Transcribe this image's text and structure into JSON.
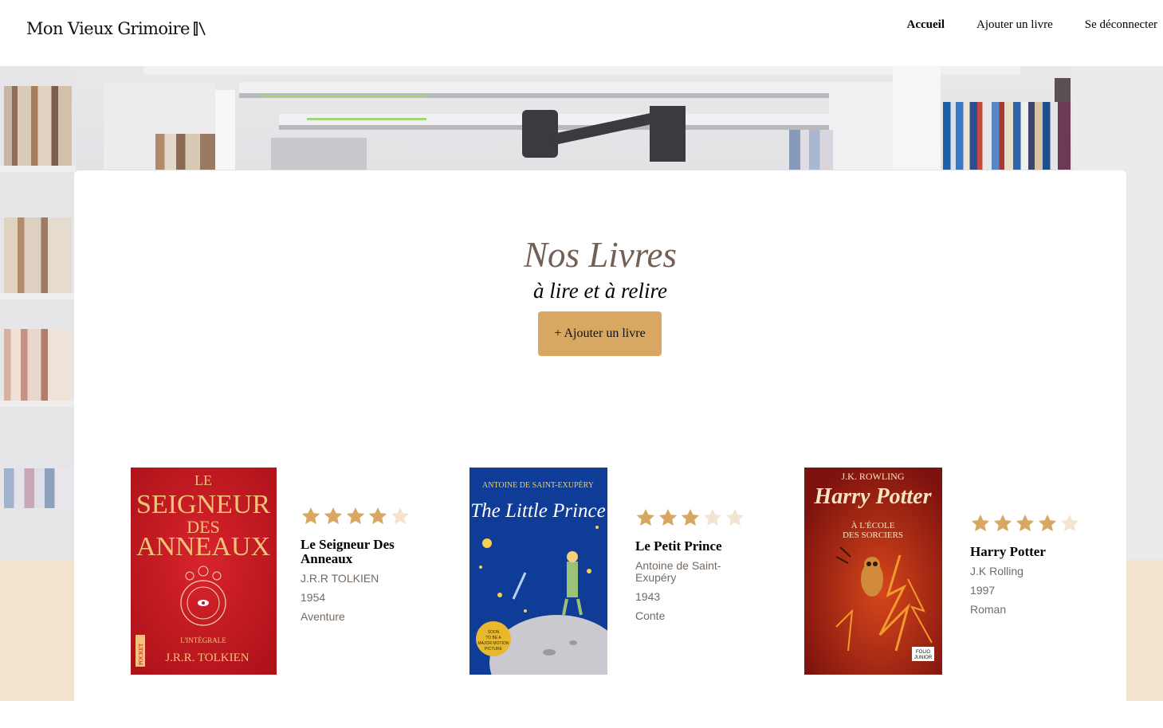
{
  "header": {
    "logo_text": "Mon Vieux Grimoire",
    "nav": [
      {
        "label": "Accueil",
        "active": true
      },
      {
        "label": "Ajouter un livre",
        "active": false
      },
      {
        "label": "Se déconnecter",
        "active": false
      }
    ]
  },
  "main": {
    "title": "Nos Livres",
    "subtitle": "à lire et à relire",
    "add_button_label": "+ Ajouter un livre"
  },
  "colors": {
    "accent": "#d8a863",
    "title": "#725f55",
    "star_filled": "#d8a863",
    "star_empty": "#f3e4cf",
    "beige_band": "#f3e4cf"
  },
  "books": [
    {
      "title": "Le Seigneur Des Anneaux",
      "author": "J.R.R TOLKIEN",
      "year": "1954",
      "genre": "Aventure",
      "rating": 4,
      "cover": {
        "top_word": "LE",
        "title_lines": [
          "SEIGNEUR",
          "DES",
          "ANNEAUX"
        ],
        "edition": "L'INTÉGRALE",
        "author": "J.R.R. TOLKIEN",
        "publisher": "POCKET"
      }
    },
    {
      "title": "Le Petit Prince",
      "author": "Antoine de Saint-Exupéry",
      "year": "1943",
      "genre": "Conte",
      "rating": 3,
      "cover": {
        "author": "ANTOINE DE SAINT-EXUPÉRY",
        "title": "The Little Prince",
        "badge": "SOON TO BE A MAJOR MOTION PICTURE"
      }
    },
    {
      "title": "Harry Potter",
      "author": "J.K Rolling",
      "year": "1997",
      "genre": "Roman",
      "rating": 4,
      "cover": {
        "author": "J.K. ROWLING",
        "title": "Harry Potter",
        "subtitle": "À L'ÉCOLE DES SORCIERS",
        "publisher": "FOLIO JUNIOR"
      }
    }
  ]
}
